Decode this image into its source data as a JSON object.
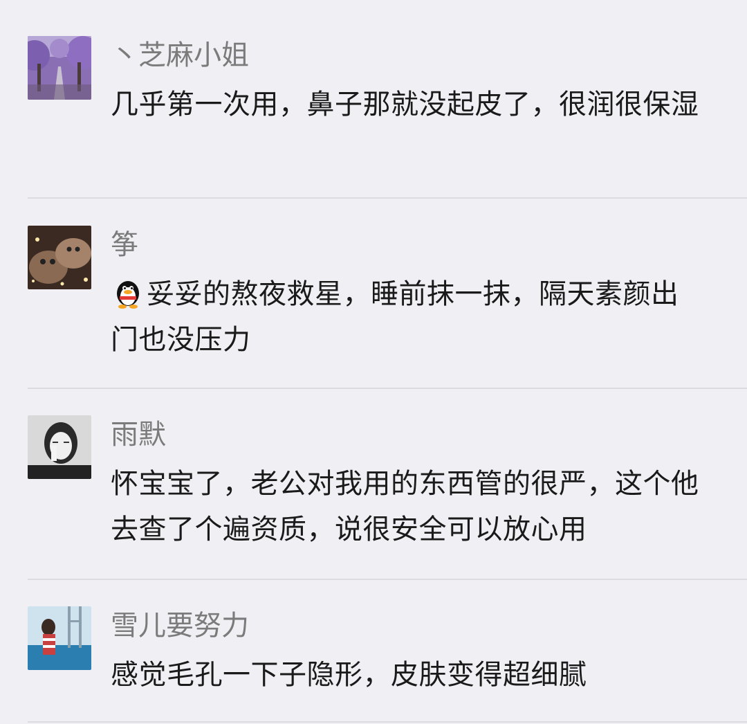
{
  "comments": [
    {
      "nickname": "丶芝麻小姐",
      "text": "几乎第一次用，鼻子那就没起皮了，很润很保湿",
      "avatar_icon": "purple-tree-lined-road-photo"
    },
    {
      "nickname": "筝",
      "text": "妥妥的熬夜救星，睡前抹一抹，隔天素颜出门也没压力",
      "emoji_icon": "qq-penguin-icon",
      "avatar_icon": "cat-photo"
    },
    {
      "nickname": "雨默",
      "text": "怀宝宝了，老公对我用的东西管的很严，这个他去查了个遍资质，说很安全可以放心用",
      "avatar_icon": "girl-selfie-photo"
    },
    {
      "nickname": "雪儿要努力",
      "text": "感觉毛孔一下子隐形，皮肤变得超细腻",
      "avatar_icon": "girl-at-pool-photo"
    }
  ],
  "colors": {
    "background": "#f0eff4",
    "nickname": "#7b7b7b",
    "text": "#1a1a1a",
    "divider": "#dcdbe0"
  }
}
